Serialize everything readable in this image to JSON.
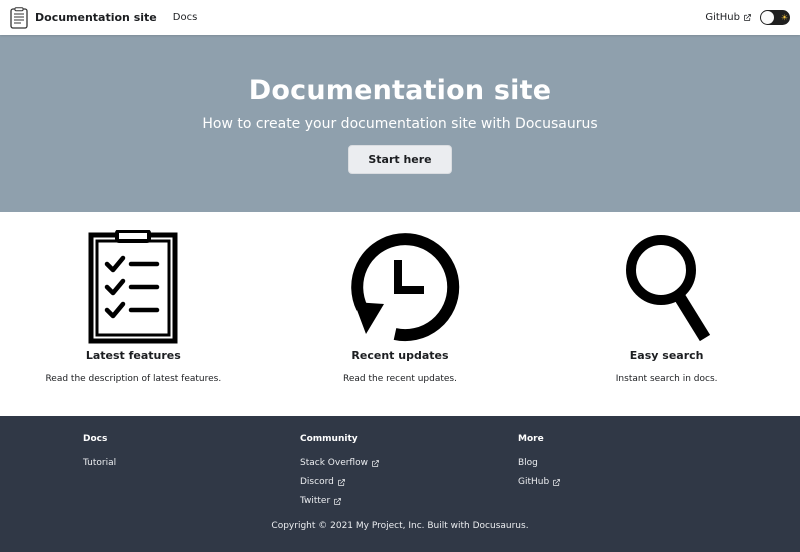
{
  "navbar": {
    "title": "Documentation site",
    "links": [
      {
        "label": "Docs"
      }
    ],
    "github_label": "GitHub",
    "theme_toggle_icon": "sun-icon"
  },
  "hero": {
    "title": "Documentation site",
    "subtitle": "How to create your documentation site with Docusaurus",
    "button_label": "Start here"
  },
  "features": [
    {
      "icon": "clipboard-checklist-icon",
      "title": "Latest features",
      "description": "Read the description of latest features."
    },
    {
      "icon": "history-clock-icon",
      "title": "Recent updates",
      "description": "Read the recent updates."
    },
    {
      "icon": "magnifier-icon",
      "title": "Easy search",
      "description": "Instant search in docs."
    }
  ],
  "footer": {
    "columns": [
      {
        "title": "Docs",
        "links": [
          {
            "label": "Tutorial",
            "external": false
          }
        ]
      },
      {
        "title": "Community",
        "links": [
          {
            "label": "Stack Overflow",
            "external": true
          },
          {
            "label": "Discord",
            "external": true
          },
          {
            "label": "Twitter",
            "external": true
          }
        ]
      },
      {
        "title": "More",
        "links": [
          {
            "label": "Blog",
            "external": false
          },
          {
            "label": "GitHub",
            "external": true
          }
        ]
      }
    ],
    "copyright": "Copyright © 2021 My Project, Inc. Built with Docusaurus."
  },
  "colors": {
    "hero_background": "#8fa0ad",
    "footer_background": "#303846",
    "button_background": "#ebedf0"
  }
}
